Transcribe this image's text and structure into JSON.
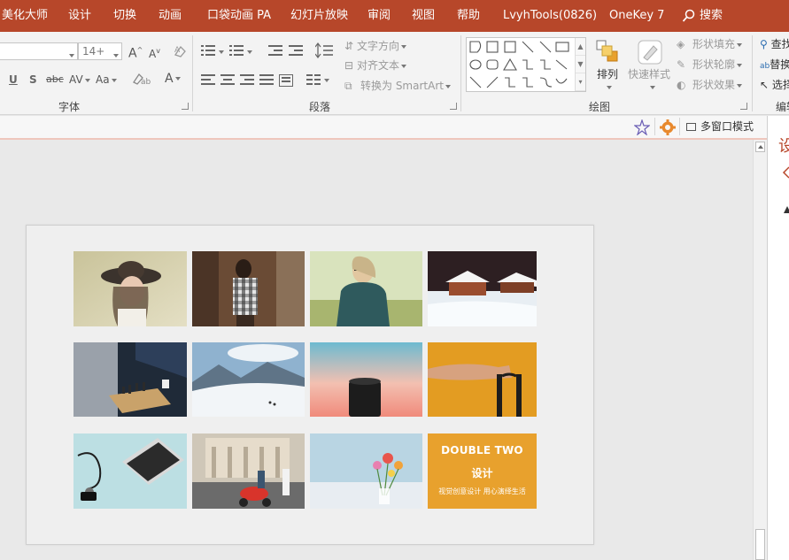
{
  "menu": {
    "items": [
      "美化大师",
      "设计",
      "切换",
      "动画",
      "口袋动画 PA",
      "幻灯片放映",
      "审阅",
      "视图",
      "帮助",
      "LvyhTools(0826)",
      "OneKey 7"
    ],
    "search_label": "搜索"
  },
  "ribbon": {
    "font": {
      "group_label": "字体",
      "size_value": "14+",
      "underline": "U",
      "shadow": "S",
      "strike": "abc",
      "spacing": "AV",
      "case": "Aa",
      "grow": "A",
      "shrink": "A",
      "color": "A"
    },
    "paragraph": {
      "group_label": "段落",
      "text_direction": "文字方向",
      "align_text": "对齐文本",
      "convert_smartart": "转换为 SmartArt"
    },
    "drawing": {
      "group_label": "绘图",
      "arrange": "排列",
      "quick_styles": "快速样式",
      "shape_fill": "形状填充",
      "shape_outline": "形状轮廓",
      "shape_effects": "形状效果"
    },
    "editing": {
      "group_label": "编辑",
      "find": "查找",
      "replace": "替换",
      "select": "选择"
    }
  },
  "strip": {
    "multi_window": "多窗口模式"
  },
  "right_pane": {
    "title": "设"
  },
  "slide": {
    "last_tile": {
      "line1": "DOUBLE TWO",
      "line2": "设计",
      "line3": "视觉创意设计 用心演绎生活"
    }
  },
  "colors": {
    "accent": "#b7472a",
    "tile_orange": "#e8a12d"
  }
}
